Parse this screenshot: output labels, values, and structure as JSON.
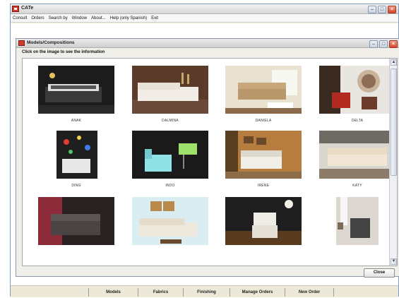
{
  "app": {
    "title": "CATe"
  },
  "menu": [
    "Consult",
    "Orders",
    "Search by",
    "Window",
    "About...",
    "Help (only Spanish)",
    "Exit"
  ],
  "child_window": {
    "title": "Models/Compositions",
    "hint": "Click on the image to see the information",
    "close_label": "Close"
  },
  "tiles": [
    {
      "label": "ANAK",
      "icon": "sofa-photo"
    },
    {
      "label": "DALMINA",
      "icon": "sofa-photo"
    },
    {
      "label": "DANIELA",
      "icon": "sofa-photo"
    },
    {
      "label": "DELTA",
      "icon": "armchair-photo"
    },
    {
      "label": "DING",
      "icon": "armchair-photo"
    },
    {
      "label": "INDO",
      "icon": "armchair-photo"
    },
    {
      "label": "IRENE",
      "icon": "sofa-photo"
    },
    {
      "label": "KATY",
      "icon": "sofa-photo"
    },
    {
      "label": "",
      "icon": "sofa-photo"
    },
    {
      "label": "",
      "icon": "sofa-photo"
    },
    {
      "label": "",
      "icon": "armchair-photo"
    },
    {
      "label": "",
      "icon": "armchair-photo"
    }
  ],
  "bottom_tabs": [
    "Models",
    "Fabrics",
    "Finishing",
    "Manage Orders",
    "New Order"
  ],
  "colors": {
    "accent_close": "#d9442a",
    "titlebar": "#d6d6d6",
    "app_icon": "#d23a2a"
  }
}
